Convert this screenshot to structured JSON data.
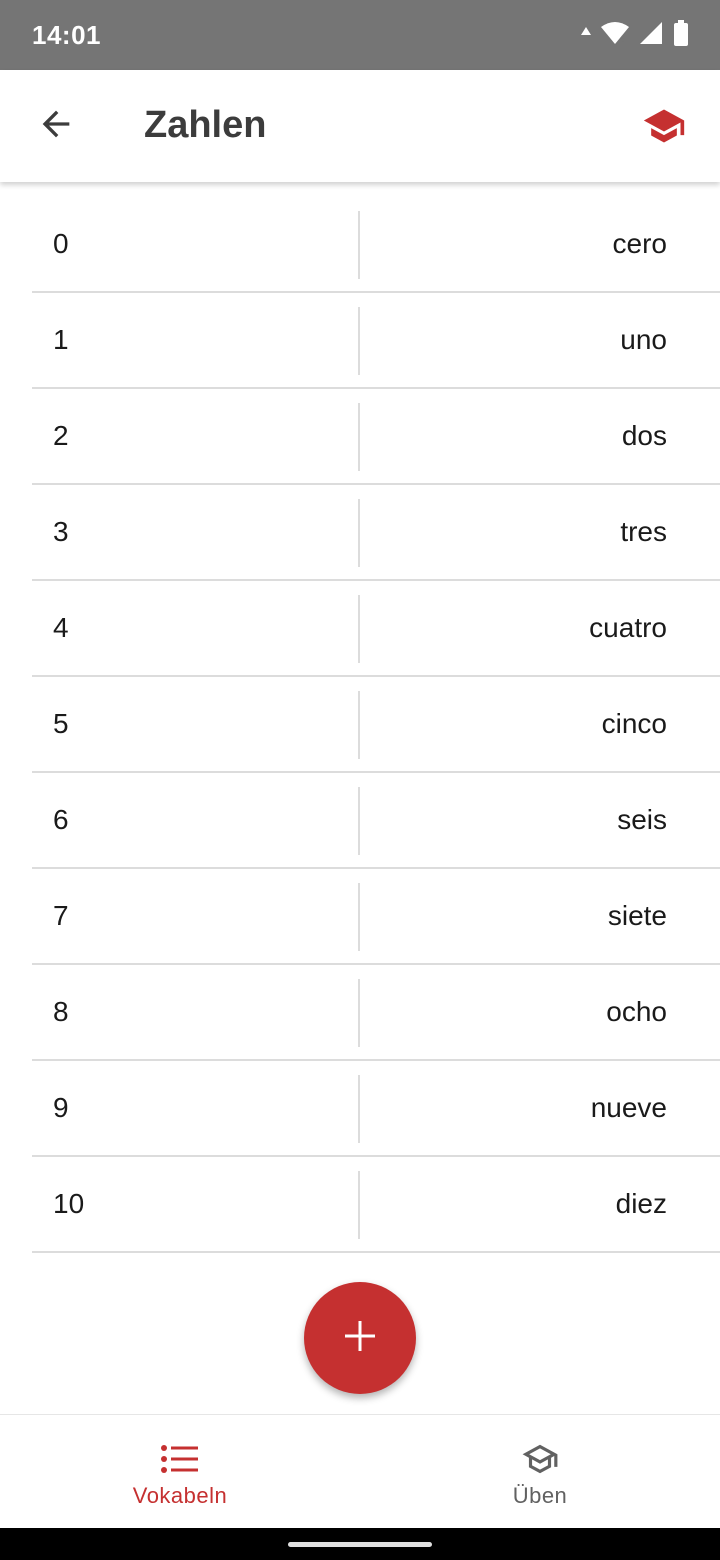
{
  "status_bar": {
    "time": "14:01"
  },
  "app_bar": {
    "title": "Zahlen"
  },
  "vocab": [
    {
      "left": "0",
      "right": "cero"
    },
    {
      "left": "1",
      "right": "uno"
    },
    {
      "left": "2",
      "right": "dos"
    },
    {
      "left": "3",
      "right": "tres"
    },
    {
      "left": "4",
      "right": "cuatro"
    },
    {
      "left": "5",
      "right": "cinco"
    },
    {
      "left": "6",
      "right": "seis"
    },
    {
      "left": "7",
      "right": "siete"
    },
    {
      "left": "8",
      "right": "ocho"
    },
    {
      "left": "9",
      "right": "nueve"
    },
    {
      "left": "10",
      "right": "diez"
    }
  ],
  "fab": {
    "icon": "plus-icon"
  },
  "bottom_nav": {
    "items": [
      {
        "label": "Vokabeln",
        "icon": "list-icon",
        "active": true
      },
      {
        "label": "Üben",
        "icon": "school-icon",
        "active": false
      }
    ]
  },
  "colors": {
    "accent": "#c53030",
    "status_bar": "#757575"
  }
}
